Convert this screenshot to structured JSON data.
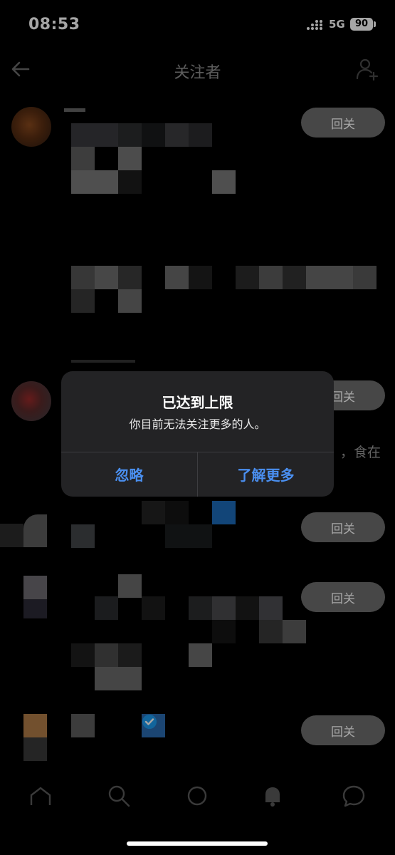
{
  "status_bar": {
    "time": "08:53",
    "network": "5G",
    "battery": "90"
  },
  "header": {
    "title": "关注者"
  },
  "list": {
    "follow_back_label": "回关",
    "snippet_text": "，食在"
  },
  "alert": {
    "title": "已达到上限",
    "message": "你目前无法关注更多的人。",
    "ignore_label": "忽略",
    "learn_more_label": "了解更多"
  },
  "colors": {
    "background": "#000000",
    "alert_bg": "#232325",
    "alert_button": "#4a8ff0",
    "follow_button_bg": "#6d6d6d"
  },
  "icons": [
    "back-arrow-icon",
    "add-user-icon",
    "home-icon",
    "search-icon",
    "spaces-icon",
    "notifications-icon",
    "messages-icon",
    "verified-badge-icon"
  ]
}
